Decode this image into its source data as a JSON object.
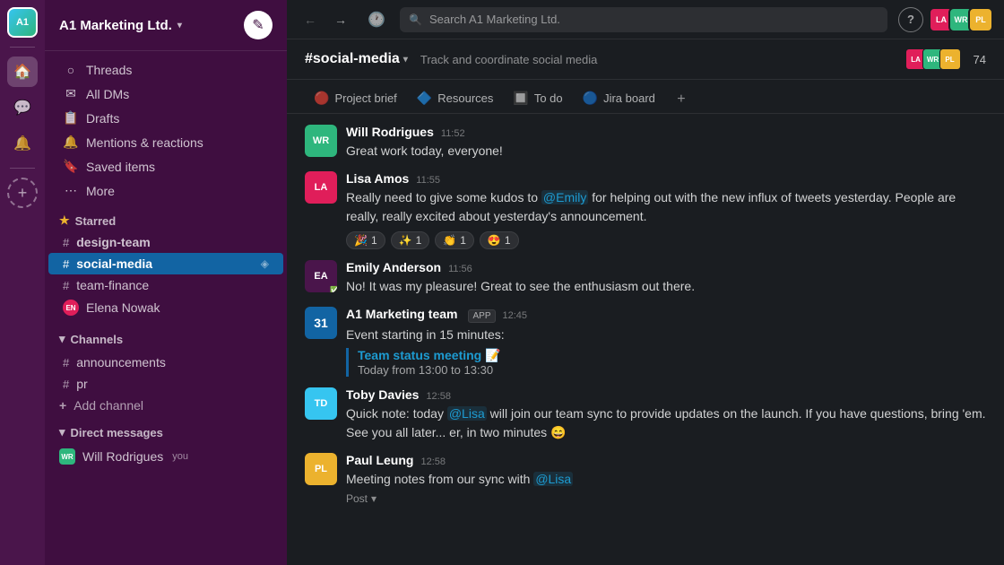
{
  "app": {
    "workspace": "A1 Marketing Ltd.",
    "workspace_chevron": "▾",
    "compose_icon": "✎",
    "search_placeholder": "Search A1 Marketing Ltd."
  },
  "topbar": {
    "back_arrow": "←",
    "forward_arrow": "→",
    "clock": "🕐",
    "help": "?",
    "member_count": "74"
  },
  "sidebar": {
    "nav_items": [
      {
        "id": "threads",
        "icon": "💬",
        "label": "Threads"
      },
      {
        "id": "all-dms",
        "icon": "✉",
        "label": "All DMs"
      },
      {
        "id": "drafts",
        "icon": "📋",
        "label": "Drafts"
      },
      {
        "id": "mentions",
        "icon": "🔔",
        "label": "Mentions & reactions"
      },
      {
        "id": "saved",
        "icon": "🔖",
        "label": "Saved items"
      },
      {
        "id": "more",
        "icon": "⋯",
        "label": "More"
      }
    ],
    "starred_label": "Starred",
    "starred_channels": [
      {
        "id": "design-team",
        "name": "design-team",
        "bold": true
      },
      {
        "id": "social-media",
        "name": "social-media",
        "active": true
      },
      {
        "id": "team-finance",
        "name": "team-finance"
      }
    ],
    "elena_dm": "Elena Nowak",
    "channels_label": "Channels",
    "channels": [
      {
        "id": "announcements",
        "name": "announcements"
      },
      {
        "id": "pr",
        "name": "pr"
      }
    ],
    "add_channel": "Add channel",
    "dm_label": "Direct messages",
    "dm_items": [
      {
        "id": "will",
        "name": "Will Rodrigues",
        "suffix": "you",
        "color": "#2eb67d"
      }
    ]
  },
  "channel": {
    "name": "#social-media",
    "description": "Track and coordinate social media",
    "member_count": "74",
    "tabs": [
      {
        "id": "project-brief",
        "icon": "🔴",
        "label": "Project brief"
      },
      {
        "id": "resources",
        "icon": "🔷",
        "label": "Resources"
      },
      {
        "id": "to-do",
        "icon": "🔲",
        "label": "To do"
      },
      {
        "id": "jira-board",
        "icon": "🔵",
        "label": "Jira board"
      }
    ]
  },
  "messages": [
    {
      "id": "msg1",
      "author": "Will Rodrigues",
      "time": "11:52",
      "text": "Great work today, everyone!",
      "avatar_color": "#2eb67d",
      "avatar_initials": "WR"
    },
    {
      "id": "msg2",
      "author": "Lisa Amos",
      "time": "11:55",
      "text_parts": [
        "Really need to give some kudos to ",
        "@Emily",
        " for helping out with the new influx of tweets yesterday. People are really, really excited about yesterday's announcement."
      ],
      "avatar_color": "#e01e5a",
      "avatar_initials": "LA",
      "reactions": [
        {
          "emoji": "🎉",
          "count": "1"
        },
        {
          "emoji": "✨",
          "count": "1"
        },
        {
          "emoji": "👏",
          "count": "1"
        },
        {
          "emoji": "😍",
          "count": "1"
        }
      ]
    },
    {
      "id": "msg3",
      "author": "Emily Anderson",
      "time": "11:56",
      "text": "No! It was my pleasure! Great to see the enthusiasm out there.",
      "avatar_color": "#4a154b",
      "avatar_initials": "EA",
      "has_verified": true
    },
    {
      "id": "msg4",
      "author": "A1 Marketing team",
      "time": "12:45",
      "text": "Event starting in 15 minutes:",
      "avatar_type": "calendar",
      "is_app": true,
      "quoted_title": "Team status meeting 📝",
      "quoted_text": "Today from 13:00 to 13:30"
    },
    {
      "id": "msg5",
      "author": "Toby Davies",
      "time": "12:58",
      "text_parts": [
        "Quick note: today ",
        "@Lisa",
        " will join our team sync to provide updates on the launch. If you have questions, bring 'em. See you all later... er, in two minutes 😄"
      ],
      "avatar_color": "#36c5f0",
      "avatar_initials": "TD"
    },
    {
      "id": "msg6",
      "author": "Paul Leung",
      "time": "12:58",
      "text_parts": [
        "Meeting notes from our sync with ",
        "@Lisa"
      ],
      "avatar_color": "#ECB22E",
      "avatar_initials": "PL",
      "has_post": true
    }
  ],
  "ui": {
    "add_channel_icon": "+",
    "post_label": "Post",
    "post_chevron": "▾"
  }
}
